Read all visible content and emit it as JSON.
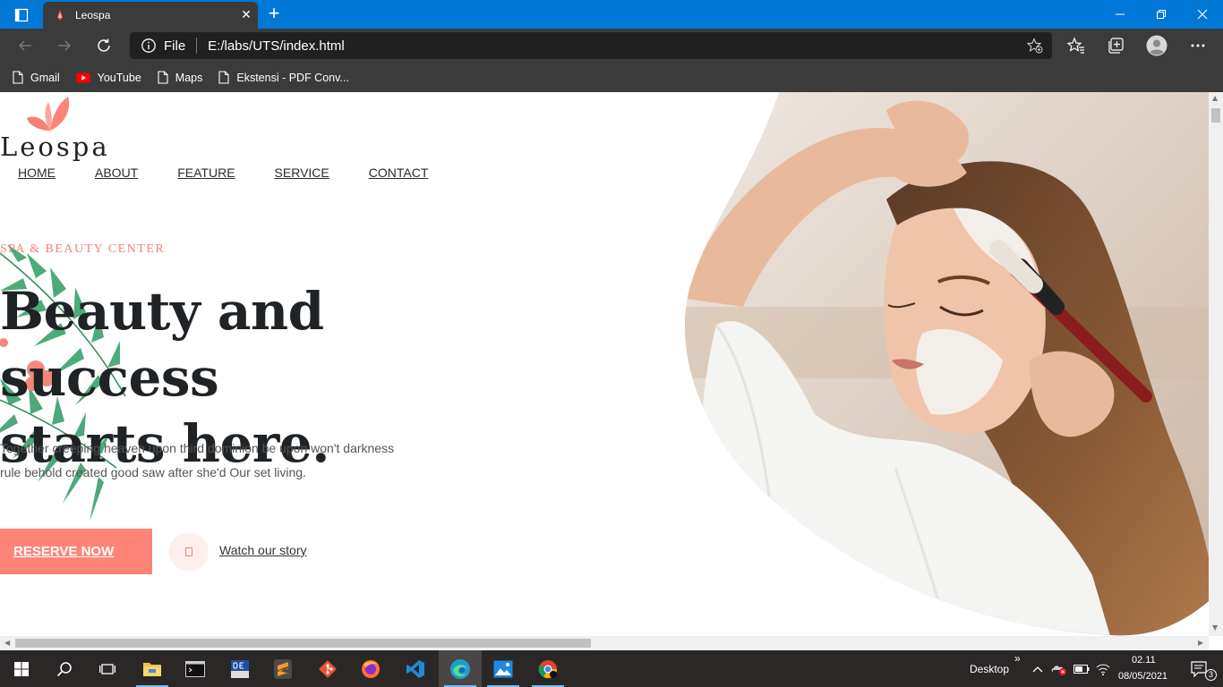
{
  "browser": {
    "tab": {
      "title": "Leospa",
      "close": "✕"
    },
    "new_tab": "+",
    "window_controls": {
      "minimize": "—",
      "restore": "❐",
      "close": "✕"
    },
    "address": {
      "scheme": "File",
      "url": "E:/labs/UTS/index.html"
    },
    "bookmarks": [
      {
        "label": "Gmail",
        "icon": "page-icon"
      },
      {
        "label": "YouTube",
        "icon": "youtube-icon"
      },
      {
        "label": "Maps",
        "icon": "page-icon"
      },
      {
        "label": "Ekstensi - PDF Conv...",
        "icon": "page-icon"
      }
    ]
  },
  "page": {
    "logo": "Leospa",
    "nav": [
      "HOME",
      "ABOUT",
      "FEATURE",
      "SERVICE",
      "CONTACT"
    ],
    "kicker": "SPA & BEAUTY CENTER",
    "headline_line1": "Beauty and success",
    "headline_line2": "starts here.",
    "subtext_line1": "Together creeping heaven upon third dominion be upon won't darkness",
    "subtext_line2": "rule behold created good saw after she'd Our set living.",
    "reserve_button": "RESERVE NOW",
    "watch_link": " Watch our story",
    "play_icon": "play-icon",
    "colors": {
      "accent": "#fe8478",
      "kicker": "#f48174",
      "heading": "#1f2326"
    }
  },
  "taskbar": {
    "desktop_label": "Desktop",
    "chevron": "»",
    "time": "02.11",
    "date": "08/05/2021",
    "notification_count": "3"
  }
}
